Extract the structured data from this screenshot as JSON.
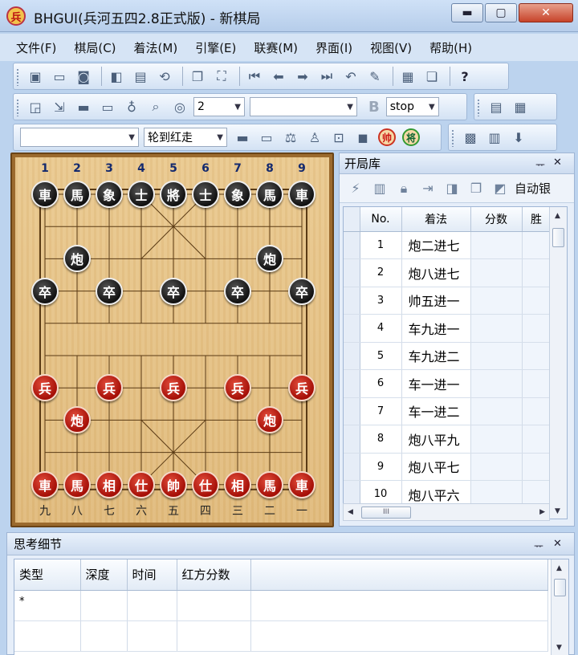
{
  "window": {
    "title": "BHGUI(兵河五四2.8正式版) - 新棋局",
    "app_icon_glyph": "兵",
    "min_glyph": "▬",
    "max_glyph": "▢",
    "close_glyph": "✕"
  },
  "menu": [
    "文件(F)",
    "棋局(C)",
    "着法(M)",
    "引擎(E)",
    "联赛(M)",
    "界面(I)",
    "视图(V)",
    "帮助(H)"
  ],
  "toolbar2": {
    "depth_value": "2",
    "stop_value": "stop",
    "b_glyph": "B"
  },
  "toolbar3": {
    "turn_value": "轮到红走",
    "shuai_glyph": "帅",
    "jiang_glyph": "将"
  },
  "board": {
    "top_numbers": [
      "1",
      "2",
      "3",
      "4",
      "5",
      "6",
      "7",
      "8",
      "9"
    ],
    "bottom_numbers": [
      "九",
      "八",
      "七",
      "六",
      "五",
      "四",
      "三",
      "二",
      "一"
    ],
    "pieces": [
      {
        "side": "black",
        "glyph": "車",
        "file": 0,
        "rank": 0
      },
      {
        "side": "black",
        "glyph": "馬",
        "file": 1,
        "rank": 0
      },
      {
        "side": "black",
        "glyph": "象",
        "file": 2,
        "rank": 0
      },
      {
        "side": "black",
        "glyph": "士",
        "file": 3,
        "rank": 0
      },
      {
        "side": "black",
        "glyph": "將",
        "file": 4,
        "rank": 0
      },
      {
        "side": "black",
        "glyph": "士",
        "file": 5,
        "rank": 0
      },
      {
        "side": "black",
        "glyph": "象",
        "file": 6,
        "rank": 0
      },
      {
        "side": "black",
        "glyph": "馬",
        "file": 7,
        "rank": 0
      },
      {
        "side": "black",
        "glyph": "車",
        "file": 8,
        "rank": 0
      },
      {
        "side": "black",
        "glyph": "炮",
        "file": 1,
        "rank": 2
      },
      {
        "side": "black",
        "glyph": "炮",
        "file": 7,
        "rank": 2
      },
      {
        "side": "black",
        "glyph": "卒",
        "file": 0,
        "rank": 3
      },
      {
        "side": "black",
        "glyph": "卒",
        "file": 2,
        "rank": 3
      },
      {
        "side": "black",
        "glyph": "卒",
        "file": 4,
        "rank": 3
      },
      {
        "side": "black",
        "glyph": "卒",
        "file": 6,
        "rank": 3
      },
      {
        "side": "black",
        "glyph": "卒",
        "file": 8,
        "rank": 3
      },
      {
        "side": "red",
        "glyph": "兵",
        "file": 0,
        "rank": 6
      },
      {
        "side": "red",
        "glyph": "兵",
        "file": 2,
        "rank": 6
      },
      {
        "side": "red",
        "glyph": "兵",
        "file": 4,
        "rank": 6
      },
      {
        "side": "red",
        "glyph": "兵",
        "file": 6,
        "rank": 6
      },
      {
        "side": "red",
        "glyph": "兵",
        "file": 8,
        "rank": 6
      },
      {
        "side": "red",
        "glyph": "炮",
        "file": 1,
        "rank": 7
      },
      {
        "side": "red",
        "glyph": "炮",
        "file": 7,
        "rank": 7
      },
      {
        "side": "red",
        "glyph": "車",
        "file": 0,
        "rank": 9
      },
      {
        "side": "red",
        "glyph": "馬",
        "file": 1,
        "rank": 9
      },
      {
        "side": "red",
        "glyph": "相",
        "file": 2,
        "rank": 9
      },
      {
        "side": "red",
        "glyph": "仕",
        "file": 3,
        "rank": 9
      },
      {
        "side": "red",
        "glyph": "帥",
        "file": 4,
        "rank": 9
      },
      {
        "side": "red",
        "glyph": "仕",
        "file": 5,
        "rank": 9
      },
      {
        "side": "red",
        "glyph": "相",
        "file": 6,
        "rank": 9
      },
      {
        "side": "red",
        "glyph": "馬",
        "file": 7,
        "rank": 9
      },
      {
        "side": "red",
        "glyph": "車",
        "file": 8,
        "rank": 9
      }
    ]
  },
  "book": {
    "title": "开局库",
    "pin_glyph": "ᅲ",
    "close_glyph": "✕",
    "auto_label": "自动银",
    "columns": [
      "No.",
      "着法",
      "分数",
      "胜"
    ],
    "rows": [
      {
        "no": "1",
        "move": "炮二进七"
      },
      {
        "no": "2",
        "move": "炮八进七"
      },
      {
        "no": "3",
        "move": "帅五进一"
      },
      {
        "no": "4",
        "move": "车九进一"
      },
      {
        "no": "5",
        "move": "车九进二"
      },
      {
        "no": "6",
        "move": "车一进一"
      },
      {
        "no": "7",
        "move": "车一进二"
      },
      {
        "no": "8",
        "move": "炮八平九"
      },
      {
        "no": "9",
        "move": "炮八平七"
      },
      {
        "no": "10",
        "move": "炮八平六"
      }
    ],
    "hscroll_grip": "III"
  },
  "think": {
    "title": "思考细节",
    "pin_glyph": "ᅲ",
    "close_glyph": "✕",
    "columns": [
      "类型",
      "深度",
      "时间",
      "红方分数"
    ],
    "rows": [
      {
        "type": "*"
      },
      {
        "type": ""
      }
    ]
  },
  "colors": {
    "board_wood": "#e6c386",
    "board_frame": "#9b6a2e",
    "grid_line": "#5a3a14",
    "red_piece": "#b3140a",
    "black_piece": "#1a1a1a"
  }
}
